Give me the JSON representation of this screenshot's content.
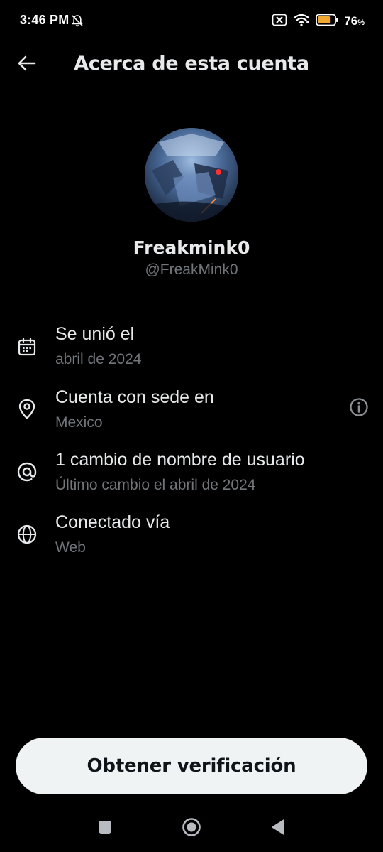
{
  "status_bar": {
    "time": "3:46 PM",
    "battery_value": "76",
    "battery_unit": "%",
    "battery_level": 0.76,
    "icons": [
      "bell-muted-icon",
      "sim-off-icon",
      "wifi-icon",
      "battery-icon"
    ]
  },
  "header": {
    "title": "Acerca de esta cuenta",
    "back_icon": "arrow-left-icon"
  },
  "profile": {
    "display_name": "Freakmink0",
    "handle": "@FreakMink0"
  },
  "info": {
    "joined": {
      "icon": "calendar-icon",
      "title": "Se unió el",
      "value": "abril de 2024"
    },
    "location": {
      "icon": "location-pin-icon",
      "title": "Cuenta con sede en",
      "value": "Mexico",
      "help_icon": "info-icon"
    },
    "username_changes": {
      "icon": "at-sign-icon",
      "title": "1 cambio de nombre de usuario",
      "value": "Último cambio el abril de 2024"
    },
    "connected": {
      "icon": "globe-icon",
      "title": "Conectado vía",
      "value": "Web"
    }
  },
  "verify_button": {
    "label": "Obtener verificación"
  },
  "nav_bar": {
    "icons": [
      "recents-square-icon",
      "home-circle-icon",
      "back-triangle-icon"
    ]
  },
  "colors": {
    "background": "#000000",
    "primary_text": "#e7e9ea",
    "secondary_text": "#71767b",
    "button_bg": "#eff3f4",
    "button_text": "#0f1419",
    "battery_fill": "#f0a830"
  }
}
